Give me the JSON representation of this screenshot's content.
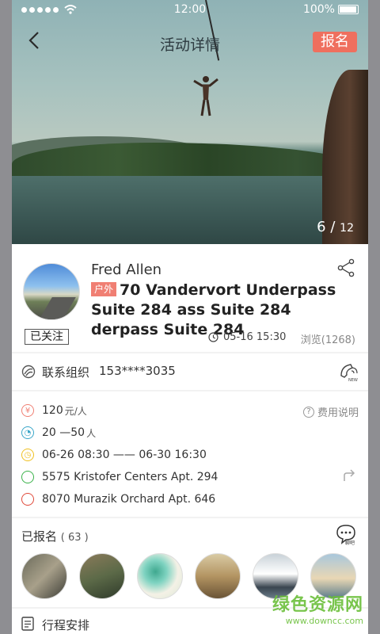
{
  "status_bar": {
    "time": "12:00",
    "battery": "100%"
  },
  "nav": {
    "title": "活动详情",
    "signup_label": "报名"
  },
  "gallery": {
    "current": "6",
    "separator": "/",
    "total": "12"
  },
  "event": {
    "author": "Fred Allen",
    "tag": "户外",
    "title": "70 Vandervort Underpass Suite 284 ass Suite 284 derpass Suite 284",
    "follow_label": "已关注",
    "datetime": "05-16 15:30",
    "views": "浏览(1268)"
  },
  "contact": {
    "label": "联系组织",
    "phone": "153****3035"
  },
  "details": {
    "price": "120",
    "price_unit": "元/人",
    "fee_note": "费用说明",
    "people_range": "20 —50",
    "people_unit": "人",
    "time_range": "06-26 08:30 —— 06-30 16:30",
    "start_address": "5575 Kristofer Centers Apt. 294",
    "end_address": "8070 Murazik Orchard Apt. 646"
  },
  "enrolled": {
    "label": "已报名",
    "count": "( 63 )",
    "chat_label": "聊吧"
  },
  "schedule": {
    "label": "行程安排"
  },
  "watermark": {
    "line1": "绿色资源网",
    "line2": "www.downcc.com"
  },
  "colors": {
    "accent": "#ef6f5e",
    "tag": "#f07f73"
  }
}
